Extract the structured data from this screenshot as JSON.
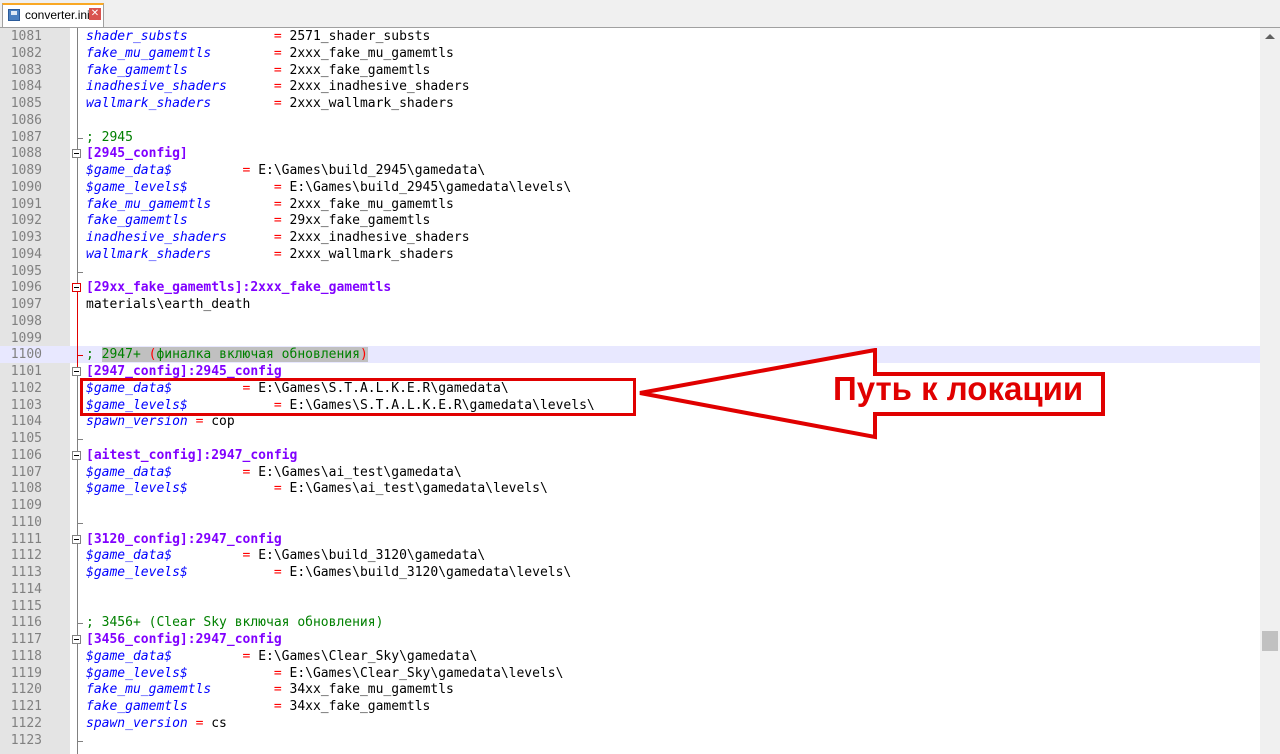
{
  "tab": {
    "title": "converter.ini",
    "icon": "save-icon",
    "close_icon": "close-icon",
    "close_glyph": "✕"
  },
  "lines": [
    {
      "n": "1081",
      "parts": [
        [
          "k",
          "shader_substs"
        ],
        [
          "s",
          "           "
        ],
        [
          "eq",
          "="
        ],
        [
          "v",
          " 2571_shader_substs"
        ]
      ]
    },
    {
      "n": "1082",
      "parts": [
        [
          "k",
          "fake_mu_gamemtls"
        ],
        [
          "s",
          "        "
        ],
        [
          "eq",
          "="
        ],
        [
          "v",
          " 2xxx_fake_mu_gamemtls"
        ]
      ]
    },
    {
      "n": "1083",
      "parts": [
        [
          "k",
          "fake_gamemtls"
        ],
        [
          "s",
          "           "
        ],
        [
          "eq",
          "="
        ],
        [
          "v",
          " 2xxx_fake_gamemtls"
        ]
      ]
    },
    {
      "n": "1084",
      "parts": [
        [
          "k",
          "inadhesive_shaders"
        ],
        [
          "s",
          "      "
        ],
        [
          "eq",
          "="
        ],
        [
          "v",
          " 2xxx_inadhesive_shaders"
        ]
      ]
    },
    {
      "n": "1085",
      "parts": [
        [
          "k",
          "wallmark_shaders"
        ],
        [
          "s",
          "        "
        ],
        [
          "eq",
          "="
        ],
        [
          "v",
          " 2xxx_wallmark_shaders"
        ]
      ]
    },
    {
      "n": "1086",
      "parts": []
    },
    {
      "n": "1087",
      "parts": [
        [
          "cm",
          "; 2945"
        ]
      ]
    },
    {
      "n": "1088",
      "parts": [
        [
          "sec",
          "[2945_config]"
        ]
      ]
    },
    {
      "n": "1089",
      "parts": [
        [
          "k",
          "$game_data$"
        ],
        [
          "s",
          "         "
        ],
        [
          "eq",
          "="
        ],
        [
          "v",
          " E:\\Games\\build_2945\\gamedata\\"
        ]
      ]
    },
    {
      "n": "1090",
      "parts": [
        [
          "k",
          "$game_levels$"
        ],
        [
          "s",
          "           "
        ],
        [
          "eq",
          "="
        ],
        [
          "v",
          " E:\\Games\\build_2945\\gamedata\\levels\\"
        ]
      ]
    },
    {
      "n": "1091",
      "parts": [
        [
          "k",
          "fake_mu_gamemtls"
        ],
        [
          "s",
          "        "
        ],
        [
          "eq",
          "="
        ],
        [
          "v",
          " 2xxx_fake_mu_gamemtls"
        ]
      ]
    },
    {
      "n": "1092",
      "parts": [
        [
          "k",
          "fake_gamemtls"
        ],
        [
          "s",
          "           "
        ],
        [
          "eq",
          "="
        ],
        [
          "v",
          " 29xx_fake_gamemtls"
        ]
      ]
    },
    {
      "n": "1093",
      "parts": [
        [
          "k",
          "inadhesive_shaders"
        ],
        [
          "s",
          "      "
        ],
        [
          "eq",
          "="
        ],
        [
          "v",
          " 2xxx_inadhesive_shaders"
        ]
      ]
    },
    {
      "n": "1094",
      "parts": [
        [
          "k",
          "wallmark_shaders"
        ],
        [
          "s",
          "        "
        ],
        [
          "eq",
          "="
        ],
        [
          "v",
          " 2xxx_wallmark_shaders"
        ]
      ]
    },
    {
      "n": "1095",
      "parts": []
    },
    {
      "n": "1096",
      "parts": [
        [
          "sec",
          "[29xx_fake_gamemtls]:2xxx_fake_gamemtls"
        ]
      ]
    },
    {
      "n": "1097",
      "parts": [
        [
          "v",
          "materials\\earth_death"
        ]
      ]
    },
    {
      "n": "1098",
      "parts": []
    },
    {
      "n": "1099",
      "parts": []
    },
    {
      "n": "1100",
      "parts": [
        [
          "cm",
          "; "
        ],
        [
          "cmhl",
          "2947+ "
        ],
        [
          "eqhl",
          "("
        ],
        [
          "cmhl",
          "финалка включая обновления"
        ],
        [
          "eqhl",
          ")"
        ]
      ]
    },
    {
      "n": "1101",
      "parts": [
        [
          "sec",
          "[2947_config]:2945_config"
        ]
      ]
    },
    {
      "n": "1102",
      "parts": [
        [
          "k",
          "$game_data$"
        ],
        [
          "s",
          "         "
        ],
        [
          "eq",
          "="
        ],
        [
          "v",
          " E:\\Games\\S.T.A.L.K.E.R\\gamedata\\"
        ]
      ]
    },
    {
      "n": "1103",
      "parts": [
        [
          "k",
          "$game_levels$"
        ],
        [
          "s",
          "           "
        ],
        [
          "eq",
          "="
        ],
        [
          "v",
          " E:\\Games\\S.T.A.L.K.E.R\\gamedata\\levels\\"
        ]
      ]
    },
    {
      "n": "1104",
      "parts": [
        [
          "k",
          "spawn_version"
        ],
        [
          "s",
          " "
        ],
        [
          "eq",
          "="
        ],
        [
          "v",
          " cop"
        ]
      ]
    },
    {
      "n": "1105",
      "parts": []
    },
    {
      "n": "1106",
      "parts": [
        [
          "sec",
          "[aitest_config]:2947_config"
        ]
      ]
    },
    {
      "n": "1107",
      "parts": [
        [
          "k",
          "$game_data$"
        ],
        [
          "s",
          "         "
        ],
        [
          "eq",
          "="
        ],
        [
          "v",
          " E:\\Games\\ai_test\\gamedata\\"
        ]
      ]
    },
    {
      "n": "1108",
      "parts": [
        [
          "k",
          "$game_levels$"
        ],
        [
          "s",
          "           "
        ],
        [
          "eq",
          "="
        ],
        [
          "v",
          " E:\\Games\\ai_test\\gamedata\\levels\\"
        ]
      ]
    },
    {
      "n": "1109",
      "parts": []
    },
    {
      "n": "1110",
      "parts": []
    },
    {
      "n": "1111",
      "parts": [
        [
          "sec",
          "[3120_config]:2947_config"
        ]
      ]
    },
    {
      "n": "1112",
      "parts": [
        [
          "k",
          "$game_data$"
        ],
        [
          "s",
          "         "
        ],
        [
          "eq",
          "="
        ],
        [
          "v",
          " E:\\Games\\build_3120\\gamedata\\"
        ]
      ]
    },
    {
      "n": "1113",
      "parts": [
        [
          "k",
          "$game_levels$"
        ],
        [
          "s",
          "           "
        ],
        [
          "eq",
          "="
        ],
        [
          "v",
          " E:\\Games\\build_3120\\gamedata\\levels\\"
        ]
      ]
    },
    {
      "n": "1114",
      "parts": []
    },
    {
      "n": "1115",
      "parts": []
    },
    {
      "n": "1116",
      "parts": [
        [
          "cm",
          "; 3456+ (Clear Sky включая обновления)"
        ]
      ]
    },
    {
      "n": "1117",
      "parts": [
        [
          "sec",
          "[3456_config]:2947_config"
        ]
      ]
    },
    {
      "n": "1118",
      "parts": [
        [
          "k",
          "$game_data$"
        ],
        [
          "s",
          "         "
        ],
        [
          "eq",
          "="
        ],
        [
          "v",
          " E:\\Games\\Clear_Sky\\gamedata\\"
        ]
      ]
    },
    {
      "n": "1119",
      "parts": [
        [
          "k",
          "$game_levels$"
        ],
        [
          "s",
          "           "
        ],
        [
          "eq",
          "="
        ],
        [
          "v",
          " E:\\Games\\Clear_Sky\\gamedata\\levels\\"
        ]
      ]
    },
    {
      "n": "1120",
      "parts": [
        [
          "k",
          "fake_mu_gamemtls"
        ],
        [
          "s",
          "        "
        ],
        [
          "eq",
          "="
        ],
        [
          "v",
          " 34xx_fake_mu_gamemtls"
        ]
      ]
    },
    {
      "n": "1121",
      "parts": [
        [
          "k",
          "fake_gamemtls"
        ],
        [
          "s",
          "           "
        ],
        [
          "eq",
          "="
        ],
        [
          "v",
          " 34xx_fake_gamemtls"
        ]
      ]
    },
    {
      "n": "1122",
      "parts": [
        [
          "k",
          "spawn_version"
        ],
        [
          "s",
          " "
        ],
        [
          "eq",
          "="
        ],
        [
          "v",
          " cs"
        ]
      ]
    },
    {
      "n": "1123",
      "parts": []
    }
  ],
  "current_line": "1100",
  "annotation": {
    "text": "Путь к локации",
    "color": "#e00000"
  },
  "colors": {
    "key": "#0000ff",
    "section": "#8000ff",
    "comment": "#008000",
    "equals": "#ff0000"
  }
}
